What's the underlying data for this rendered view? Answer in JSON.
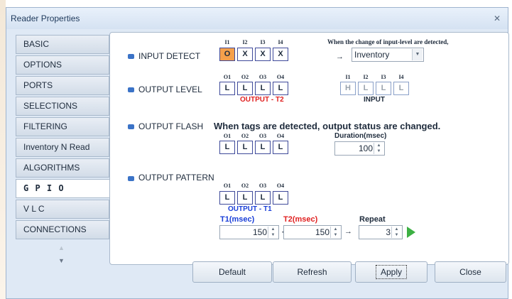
{
  "window": {
    "title": "Reader Properties",
    "close_icon": "close-icon"
  },
  "sidebar": {
    "items": [
      {
        "label": "BASIC"
      },
      {
        "label": "OPTIONS"
      },
      {
        "label": "PORTS"
      },
      {
        "label": "SELECTIONS"
      },
      {
        "label": "FILTERING"
      },
      {
        "label": "Inventory N Read"
      },
      {
        "label": "ALGORITHMS"
      },
      {
        "label": "G P I O",
        "active": true
      },
      {
        "label": "V L C"
      },
      {
        "label": "CONNECTIONS"
      }
    ],
    "scroll_up": "▲",
    "scroll_down": "▼"
  },
  "input_detect": {
    "label": "INPUT DETECT",
    "headers": [
      "I1",
      "I2",
      "I3",
      "I4"
    ],
    "values": [
      "O",
      "X",
      "X",
      "X"
    ],
    "note": "When the change of input-level are detected,",
    "arrow": "→",
    "action": "Inventory",
    "dropdown_arrow": "▼"
  },
  "output_level": {
    "label": "OUTPUT LEVEL",
    "headers": [
      "O1",
      "O2",
      "O3",
      "O4"
    ],
    "values": [
      "L",
      "L",
      "L",
      "L"
    ],
    "caption": "OUTPUT - T2",
    "input_headers": [
      "I1",
      "I2",
      "I3",
      "I4"
    ],
    "input_values": [
      "H",
      "L",
      "L",
      "L"
    ],
    "input_caption": "INPUT"
  },
  "output_flash": {
    "label": "OUTPUT FLASH",
    "note": "When tags are detected, output status are changed.",
    "headers": [
      "O1",
      "O2",
      "O3",
      "O4"
    ],
    "values": [
      "L",
      "L",
      "L",
      "L"
    ],
    "duration_label": "Duration(msec)",
    "duration_value": "100"
  },
  "output_pattern": {
    "label": "OUTPUT PATTERN",
    "headers": [
      "O1",
      "O2",
      "O3",
      "O4"
    ],
    "values": [
      "L",
      "L",
      "L",
      "L"
    ],
    "caption": "OUTPUT - T1",
    "t1_label": "T1(msec)",
    "t1_value": "150",
    "plus": "+",
    "t2_label": "T2(msec)",
    "t2_value": "150",
    "arrow": "→",
    "repeat_label": "Repeat",
    "repeat_value": "3",
    "play_icon": "play-icon"
  },
  "spin_up": "▲",
  "spin_down": "▼",
  "buttons": {
    "default": "Default",
    "refresh": "Refresh",
    "apply": "Apply",
    "close": "Close"
  },
  "colors": {
    "accent_orange": "#f5a04b",
    "caption_red": "#e02020",
    "caption_blue": "#1a3fd8",
    "play_green": "#3cb043"
  }
}
